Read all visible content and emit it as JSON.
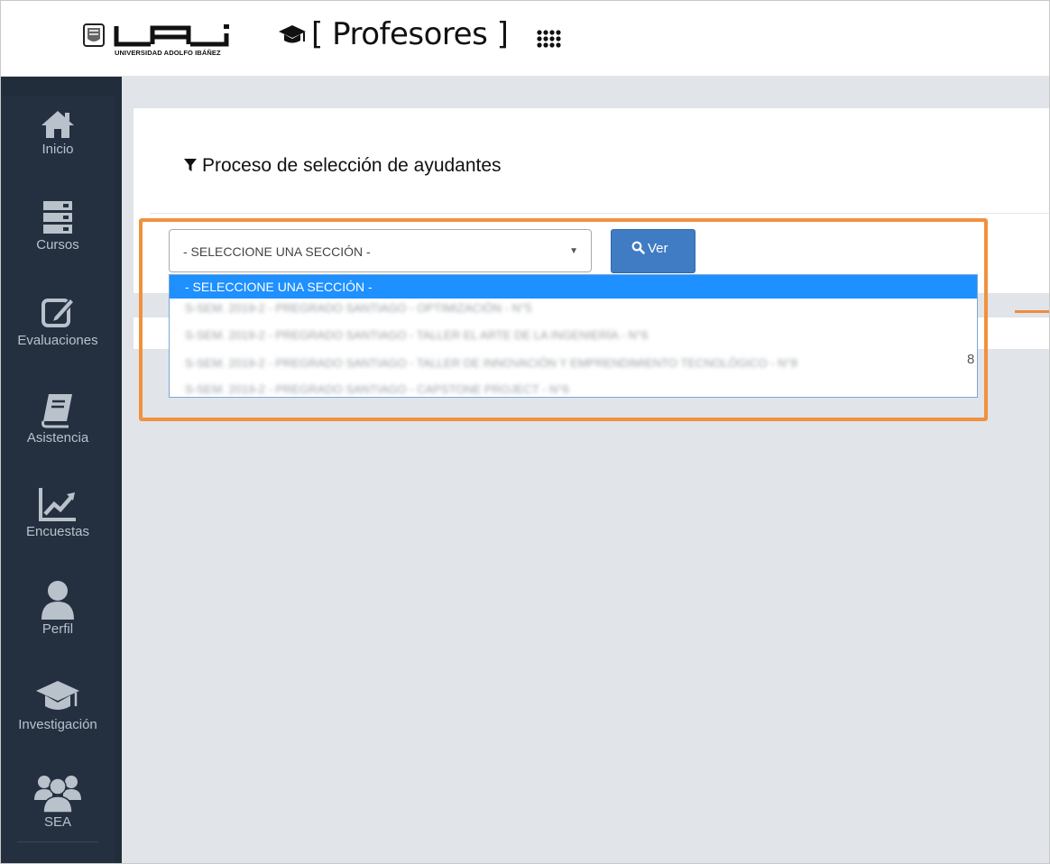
{
  "header": {
    "logo_text": "UAI",
    "logo_subtitle": "UNIVERSIDAD ADOLFO IBÁÑEZ",
    "app_title": "[ Profesores ]",
    "icons": [
      "graduation-cap-icon",
      "apps-grid-icon"
    ]
  },
  "sidebar": {
    "items": [
      {
        "label": "Inicio",
        "icon": "home-icon"
      },
      {
        "label": "Cursos",
        "icon": "server-icon"
      },
      {
        "label": "Evaluaciones",
        "icon": "edit-icon"
      },
      {
        "label": "Asistencia",
        "icon": "book-icon"
      },
      {
        "label": "Encuestas",
        "icon": "line-chart-icon"
      },
      {
        "label": "Perfil",
        "icon": "user-icon"
      },
      {
        "label": "Investigación",
        "icon": "graduation-cap-icon"
      },
      {
        "label": "SEA",
        "icon": "users-icon"
      }
    ]
  },
  "main": {
    "title": "Proceso de selección de ayudantes",
    "select": {
      "value": "- SELECCIONE UNA SECCIÓN -"
    },
    "button_label": "Ver",
    "dropdown_options": [
      "- SELECCIONE UNA SECCIÓN -",
      "S-SEM. 2019-2 - PREGRADO SANTIAGO - OPTIMIZACIÓN - N°5",
      "S-SEM. 2019-2 - PREGRADO SANTIAGO - TALLER EL ARTE DE LA INGENIERÍA - N°6",
      "S-SEM. 2019-2 - PREGRADO SANTIAGO - TALLER DE INNOVACIÓN Y EMPRENDIMIENTO TECNOLÓGICO - N°8",
      "S-SEM. 2019-2 - PREGRADO SANTIAGO - CAPSTONE PROJECT - N°6"
    ],
    "trailing_digit": "8"
  },
  "colors": {
    "sidebar_bg": "#222d3b",
    "sidebar_text": "#b9c1cb",
    "button_bg": "#3f7cc3",
    "selected_option": "#1e90ff",
    "highlight_border": "#f0913d",
    "content_bg": "#e1e4e9"
  }
}
